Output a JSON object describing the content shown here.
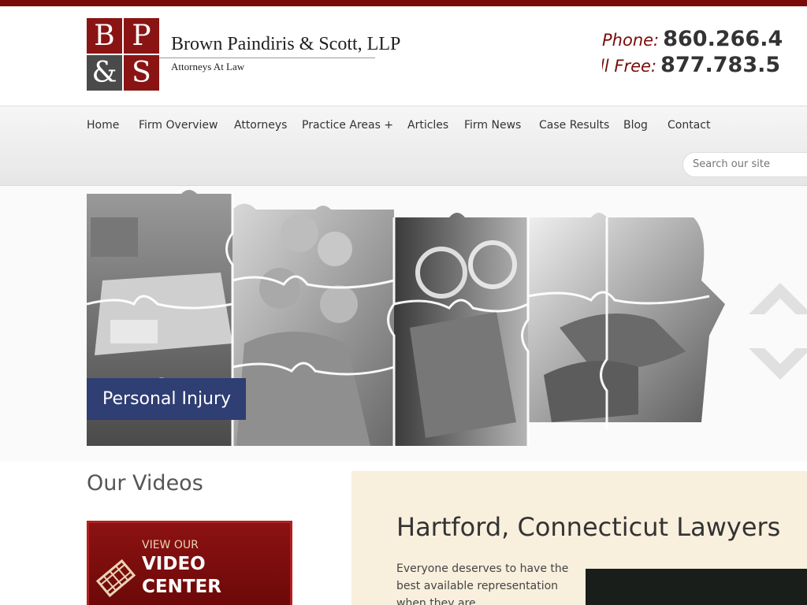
{
  "header": {
    "logo": {
      "letters": [
        "B",
        "P",
        "&",
        "S"
      ],
      "name": "Brown Paindiris & Scott, LLP",
      "tagline": "Attorneys At Law"
    },
    "phone_label": "Phone:",
    "phone_number": "860.266.4",
    "tollfree_label": "Toll Free:",
    "tollfree_number": "877.783.5"
  },
  "nav": {
    "items": [
      {
        "label": "Home"
      },
      {
        "label": "Firm Overview"
      },
      {
        "label": "Attorneys"
      },
      {
        "label": "Practice Areas +"
      },
      {
        "label": "Articles"
      },
      {
        "label": "Firm News"
      },
      {
        "label": "Case Results"
      },
      {
        "label": "Blog"
      },
      {
        "label": "Contact"
      }
    ],
    "search_placeholder": "Search our site"
  },
  "hero": {
    "caption": "Personal Injury"
  },
  "videos": {
    "title": "Our Videos",
    "view_label": "VIEW OUR",
    "main_line1": "VIDEO",
    "main_line2": "CENTER"
  },
  "content": {
    "title": "Hartford, Connecticut Lawyers",
    "text": "Everyone deserves to have the best available representation when they are"
  },
  "colors": {
    "brand": "#7b0a0a",
    "caption_bg": "#2f3e73",
    "content_bg": "#f8efdd"
  }
}
